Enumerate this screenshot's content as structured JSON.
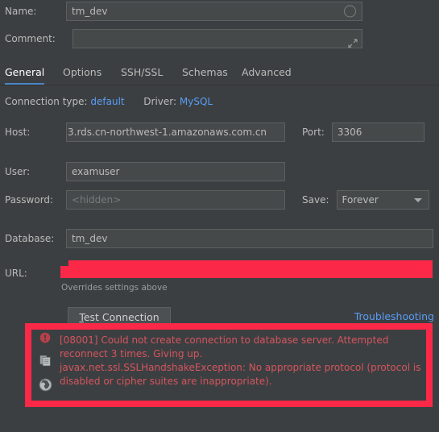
{
  "name_row": {
    "label": "Name:",
    "value": "tm_dev",
    "icon": "circle-icon"
  },
  "comment_row": {
    "label": "Comment:",
    "value": "",
    "placeholder": "",
    "icon": "expand-icon"
  },
  "tabs": [
    {
      "label": "General",
      "active": true
    },
    {
      "label": "Options",
      "active": false
    },
    {
      "label": "SSH/SSL",
      "active": false
    },
    {
      "label": "Schemas",
      "active": false
    },
    {
      "label": "Advanced",
      "active": false
    }
  ],
  "connection_info": {
    "type_label": "Connection type:",
    "type_value": "default",
    "driver_label": "Driver:",
    "driver_value": "MySQL"
  },
  "host_row": {
    "label": "Host:",
    "value": "3.rds.cn-northwest-1.amazonaws.com.cn"
  },
  "port_row": {
    "label": "Port:",
    "value": "3306"
  },
  "user_row": {
    "label": "User:",
    "value": "examuser"
  },
  "password_row": {
    "label": "Password:",
    "value": "",
    "placeholder": "<hidden>"
  },
  "save_row": {
    "label": "Save:",
    "value": "Forever",
    "icon": "chevron-down-icon"
  },
  "database_row": {
    "label": "Database:",
    "value": "tm_dev"
  },
  "url_row": {
    "label": "URL:",
    "value": "",
    "redacted": true,
    "note": "Overrides settings above"
  },
  "actions": {
    "test_connection_mnemonic": "T",
    "test_connection_rest": "est Connection",
    "troubleshooting_label": "Troubleshooting"
  },
  "error_panel": {
    "icons": [
      "error-circle-icon",
      "copy-icon",
      "globe-icon"
    ],
    "line1": "[08001] Could not create connection to database server. Attempted reconnect 3 times. Giving up.",
    "line2": "javax.net.ssl.SSLHandshakeException: No appropriate protocol (protocol is disabled or cipher suites are inappropriate)."
  },
  "colors": {
    "background": "#3c3f41",
    "field_bg": "#45494a",
    "field_border": "#5e6060",
    "text": "#bbbbbb",
    "link": "#589df6",
    "tab_underline": "#4a88c7",
    "redaction": "#fc2847",
    "error_text": "#d4555f"
  }
}
